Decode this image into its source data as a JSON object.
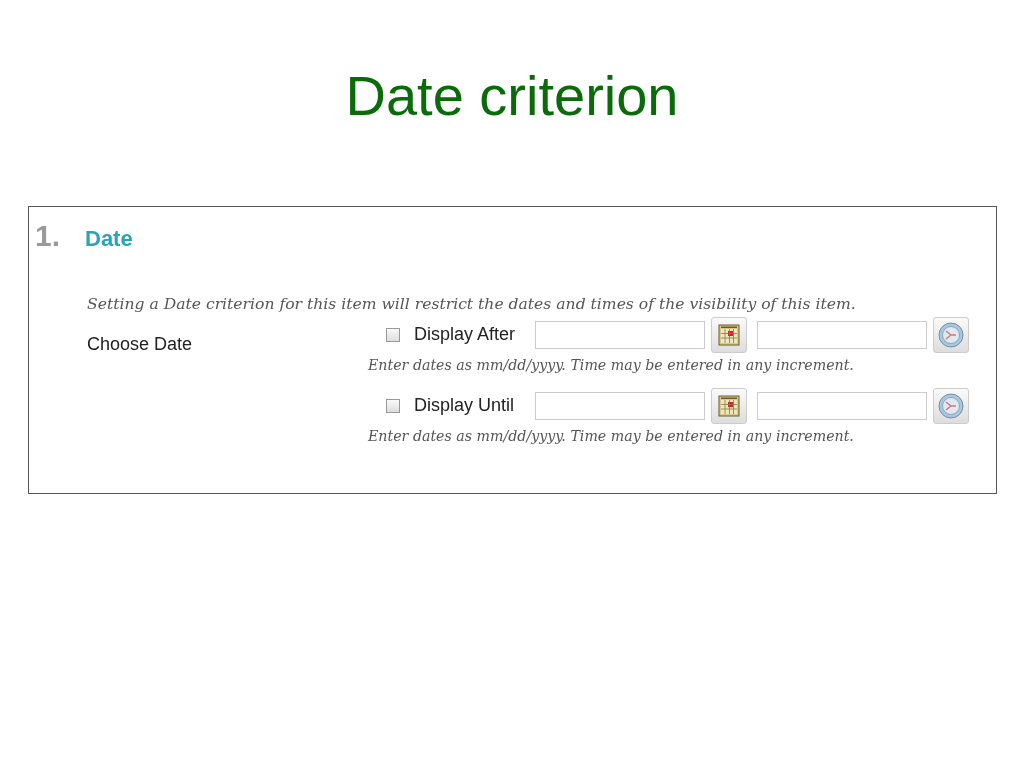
{
  "slide_title": "Date criterion",
  "section": {
    "number": "1.",
    "title": "Date"
  },
  "description": "Setting a Date criterion for this item will restrict the dates and times of the visibility of this item.",
  "field_label": "Choose Date",
  "options": [
    {
      "label": "Display After",
      "checked": false,
      "hint": "Enter dates as mm/dd/yyyy. Time may be entered in any increment."
    },
    {
      "label": "Display Until",
      "checked": false,
      "hint": "Enter dates as mm/dd/yyyy. Time may be entered in any increment."
    }
  ]
}
